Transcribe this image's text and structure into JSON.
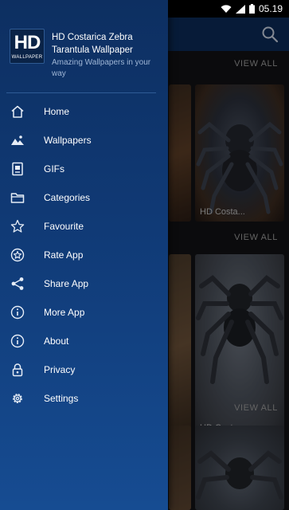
{
  "status_bar": {
    "time": "05.19"
  },
  "drawer": {
    "logo_text": "HD",
    "logo_subtext": "WALLPAPER",
    "app_title": "HD Costarica Zebra Tarantula Wallpaper",
    "app_tagline": "Amazing Wallpapers in your way",
    "menu": [
      {
        "label": "Home",
        "icon": "home-icon"
      },
      {
        "label": "Wallpapers",
        "icon": "image-icon"
      },
      {
        "label": "GIFs",
        "icon": "gif-icon"
      },
      {
        "label": "Categories",
        "icon": "folder-icon"
      },
      {
        "label": "Favourite",
        "icon": "star-icon"
      },
      {
        "label": "Rate App",
        "icon": "star-circle-icon"
      },
      {
        "label": "Share App",
        "icon": "share-icon"
      },
      {
        "label": "More App",
        "icon": "info-icon"
      },
      {
        "label": "About",
        "icon": "info-icon"
      },
      {
        "label": "Privacy",
        "icon": "lock-icon"
      },
      {
        "label": "Settings",
        "icon": "gear-icon"
      }
    ]
  },
  "content": {
    "sections": [
      {
        "view_all": "VIEW ALL",
        "caption": "HD Costa..."
      },
      {
        "view_all": "VIEW ALL",
        "caption": "HD Costa..."
      },
      {
        "view_all": "VIEW ALL",
        "caption": ""
      }
    ]
  },
  "colors": {
    "drawer_top": "#0d2f61",
    "drawer_bottom": "#164c92",
    "appbar": "#0c2a57"
  }
}
